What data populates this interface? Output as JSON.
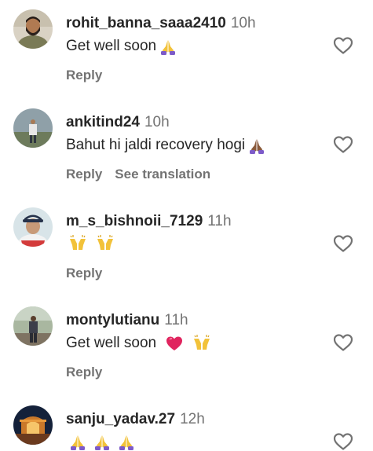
{
  "comments": [
    {
      "username": "rohit_banna_saaa2410",
      "time": "10h",
      "text": "Get well soon",
      "emojis": [
        "folded-hands-emoji"
      ],
      "actions": [
        "Reply"
      ],
      "avatar": "man-with-beard-avatar"
    },
    {
      "username": "ankitind24",
      "time": "10h",
      "text": "Bahut hi jaldi recovery hogi",
      "emojis": [
        "folded-hands-dark-emoji"
      ],
      "actions": [
        "Reply",
        "See translation"
      ],
      "avatar": "man-outdoors-avatar"
    },
    {
      "username": "m_s_bishnoii_7129",
      "time": "11h",
      "text": "",
      "emojis": [
        "raising-hands-emoji",
        "raising-hands-emoji"
      ],
      "actions": [
        "Reply"
      ],
      "avatar": "man-with-cap-avatar"
    },
    {
      "username": "montylutianu",
      "time": "11h",
      "text": "Get well soon",
      "emojis": [
        "heart-emoji",
        "raising-hands-emoji"
      ],
      "actions": [
        "Reply"
      ],
      "avatar": "man-standing-avatar"
    },
    {
      "username": "sanju_yadav.27",
      "time": "12h",
      "text": "",
      "emojis": [
        "folded-hands-emoji",
        "folded-hands-emoji",
        "folded-hands-emoji"
      ],
      "actions": [],
      "avatar": "temple-night-avatar"
    }
  ],
  "colors": {
    "text": "#262626",
    "secondary": "#737373",
    "background": "#ffffff"
  }
}
